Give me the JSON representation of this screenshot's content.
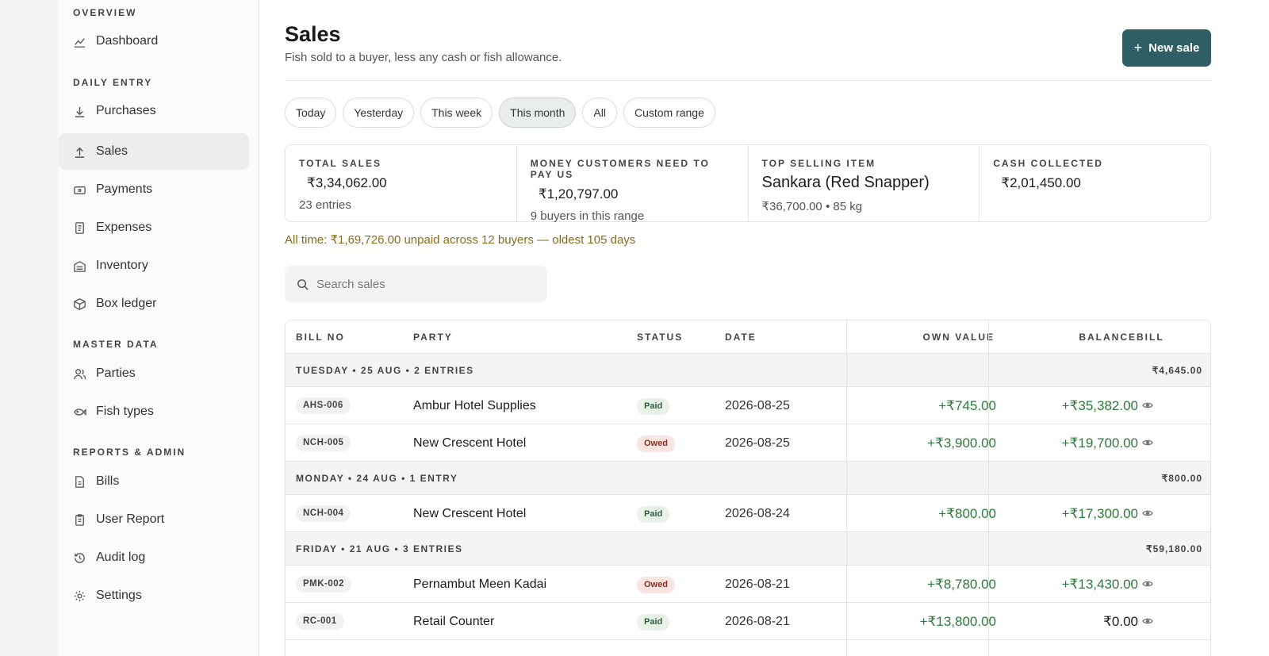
{
  "sidebar": {
    "sections": [
      {
        "title": "OVERVIEW"
      },
      {
        "title": "DAILY ENTRY"
      },
      {
        "title": "MASTER DATA"
      },
      {
        "title": "REPORTS & ADMIN"
      }
    ],
    "items": [
      {
        "label": "Dashboard",
        "icon": "chart-icon"
      },
      {
        "label": "Purchases",
        "icon": "arrow-down-icon"
      },
      {
        "label": "Sales",
        "icon": "arrow-up-icon"
      },
      {
        "label": "Payments",
        "icon": "wallet-icon"
      },
      {
        "label": "Expenses",
        "icon": "receipt-icon"
      },
      {
        "label": "Inventory",
        "icon": "warehouse-icon"
      },
      {
        "label": "Box ledger",
        "icon": "box-icon"
      },
      {
        "label": "Parties",
        "icon": "users-icon"
      },
      {
        "label": "Fish types",
        "icon": "fish-icon"
      },
      {
        "label": "Bills",
        "icon": "file-icon"
      },
      {
        "label": "User Report",
        "icon": "clipboard-icon"
      },
      {
        "label": "Audit log",
        "icon": "history-icon"
      },
      {
        "label": "Settings",
        "icon": "gear-icon"
      }
    ]
  },
  "header": {
    "title": "Sales",
    "subtitle": "Fish sold to a buyer, less any cash or fish allowance.",
    "new_button": "New sale"
  },
  "filters": [
    "Today",
    "Yesterday",
    "This week",
    "This month",
    "All",
    "Custom range"
  ],
  "active_filter": "This month",
  "stats": {
    "total_sales": {
      "label": "TOTAL SALES",
      "value": "₹3,34,062.00",
      "sub": "23 entries"
    },
    "receivable": {
      "label": "MONEY CUSTOMERS NEED TO PAY US",
      "value": "₹1,20,797.00",
      "sub": "9 buyers in this range"
    },
    "top_item": {
      "label": "TOP SELLING ITEM",
      "value": "Sankara (Red Snapper)",
      "sub": "₹36,700.00 • 85 kg"
    },
    "cash": {
      "label": "CASH COLLECTED",
      "value": "₹2,01,450.00"
    }
  },
  "alltime_note": "All time: ₹1,69,726.00 unpaid across 12 buyers — oldest 105 days",
  "search": {
    "placeholder": "Search sales"
  },
  "table": {
    "headers": {
      "bill_no": "BILL NO",
      "party": "PARTY",
      "status": "STATUS",
      "date": "DATE",
      "own_value": "OWN VALUE",
      "balance": "BALANCE",
      "bill": "BILL"
    },
    "groups": [
      {
        "label": "TUESDAY • 25 AUG • 2 ENTRIES",
        "total": "₹4,645.00"
      },
      {
        "label": "MONDAY • 24 AUG • 1 ENTRY",
        "total": "₹800.00"
      },
      {
        "label": "FRIDAY • 21 AUG • 3 ENTRIES",
        "total": "₹59,180.00"
      }
    ],
    "rows": [
      {
        "bill": "AHS-006",
        "party": "Ambur Hotel Supplies",
        "status": "Paid",
        "date": "2026-08-25",
        "own": "+₹745.00",
        "balance": "+₹35,382.00"
      },
      {
        "bill": "NCH-005",
        "party": "New Crescent Hotel",
        "status": "Owed",
        "date": "2026-08-25",
        "own": "+₹3,900.00",
        "balance": "+₹19,700.00"
      },
      {
        "bill": "NCH-004",
        "party": "New Crescent Hotel",
        "status": "Paid",
        "date": "2026-08-24",
        "own": "+₹800.00",
        "balance": "+₹17,300.00"
      },
      {
        "bill": "PMK-002",
        "party": "Pernambut Meen Kadai",
        "status": "Owed",
        "date": "2026-08-21",
        "own": "+₹8,780.00",
        "balance": "+₹13,430.00"
      },
      {
        "bill": "RC-001",
        "party": "Retail Counter",
        "status": "Paid",
        "date": "2026-08-21",
        "own": "+₹13,800.00",
        "balance": "₹0.00"
      }
    ]
  },
  "colors": {
    "accent": "#2f5f64",
    "positive": "#2d7a3a",
    "owed": "#8a2d1d",
    "warning_text": "#8a6a1f"
  }
}
